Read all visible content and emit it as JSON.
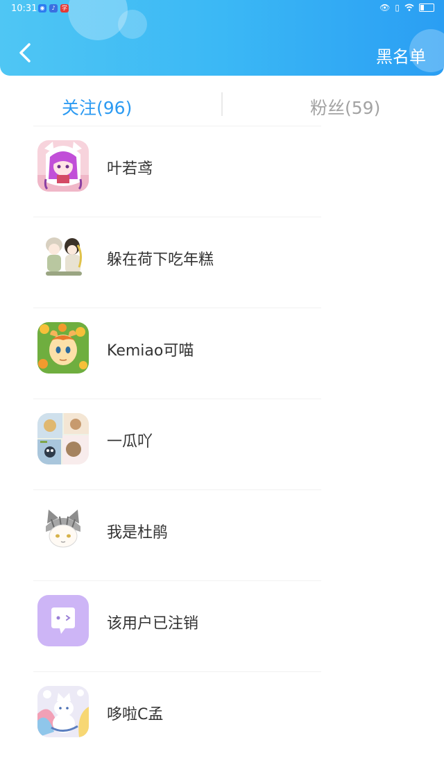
{
  "status_bar": {
    "time": "10:31",
    "app_icons": [
      "browser-app-icon",
      "music-app-icon",
      "study-app-icon"
    ],
    "study_label": "学"
  },
  "header": {
    "right_action": "黑名单"
  },
  "tabs": [
    {
      "label": "关注(96)",
      "active": true
    },
    {
      "label": "粉丝(59)",
      "active": false
    }
  ],
  "users": [
    {
      "name": "叶若鸢",
      "avatar": "pink-hair-anime-girl-avatar"
    },
    {
      "name": "躲在荷下吃年糕",
      "avatar": "two-anime-girls-avatar"
    },
    {
      "name": "Kemiao可喵",
      "avatar": "orange-pony-flowers-avatar"
    },
    {
      "name": "一瓜吖",
      "avatar": "collage-pastel-avatar"
    },
    {
      "name": "我是杜鹃",
      "avatar": "gray-cat-ears-avatar"
    },
    {
      "name": "该用户已注销",
      "avatar": "deleted-user-chat-avatar"
    },
    {
      "name": "哆啦C孟",
      "avatar": "white-cat-colorful-avatar"
    }
  ],
  "colors": {
    "header_start": "#4fc6f4",
    "header_end": "#2a9ef3",
    "active_tab": "#2b9af2",
    "inactive_tab": "#a3a3a3",
    "deleted_avatar": "#cdb5f6"
  }
}
